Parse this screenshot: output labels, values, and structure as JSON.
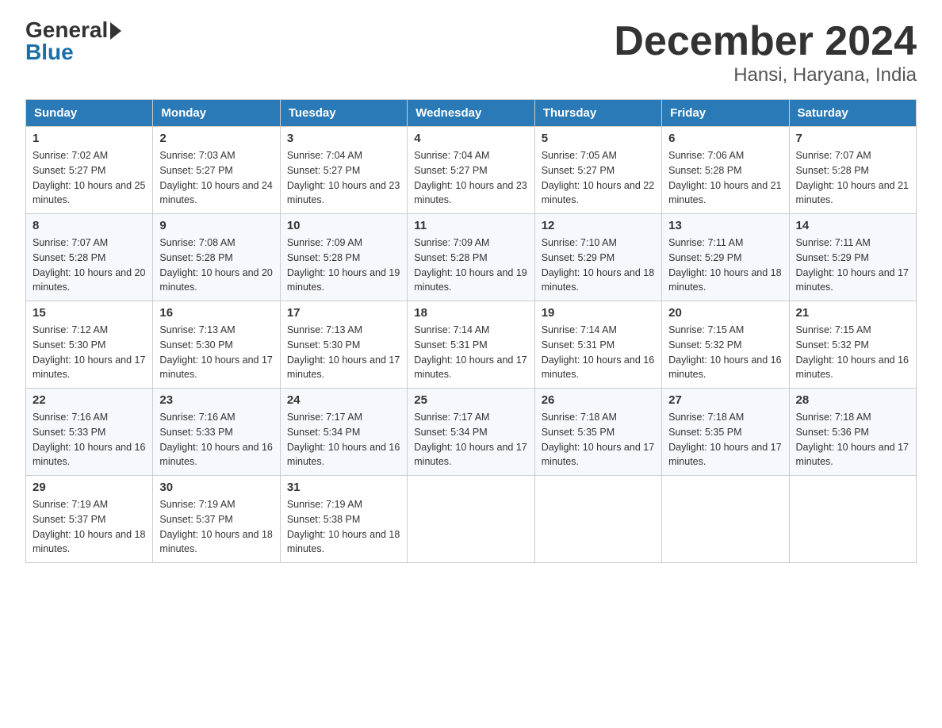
{
  "header": {
    "logo_general": "General",
    "logo_blue": "Blue",
    "month_title": "December 2024",
    "location": "Hansi, Haryana, India"
  },
  "weekdays": [
    "Sunday",
    "Monday",
    "Tuesday",
    "Wednesday",
    "Thursday",
    "Friday",
    "Saturday"
  ],
  "weeks": [
    [
      {
        "day": "1",
        "sunrise": "7:02 AM",
        "sunset": "5:27 PM",
        "daylight": "10 hours and 25 minutes."
      },
      {
        "day": "2",
        "sunrise": "7:03 AM",
        "sunset": "5:27 PM",
        "daylight": "10 hours and 24 minutes."
      },
      {
        "day": "3",
        "sunrise": "7:04 AM",
        "sunset": "5:27 PM",
        "daylight": "10 hours and 23 minutes."
      },
      {
        "day": "4",
        "sunrise": "7:04 AM",
        "sunset": "5:27 PM",
        "daylight": "10 hours and 23 minutes."
      },
      {
        "day": "5",
        "sunrise": "7:05 AM",
        "sunset": "5:27 PM",
        "daylight": "10 hours and 22 minutes."
      },
      {
        "day": "6",
        "sunrise": "7:06 AM",
        "sunset": "5:28 PM",
        "daylight": "10 hours and 21 minutes."
      },
      {
        "day": "7",
        "sunrise": "7:07 AM",
        "sunset": "5:28 PM",
        "daylight": "10 hours and 21 minutes."
      }
    ],
    [
      {
        "day": "8",
        "sunrise": "7:07 AM",
        "sunset": "5:28 PM",
        "daylight": "10 hours and 20 minutes."
      },
      {
        "day": "9",
        "sunrise": "7:08 AM",
        "sunset": "5:28 PM",
        "daylight": "10 hours and 20 minutes."
      },
      {
        "day": "10",
        "sunrise": "7:09 AM",
        "sunset": "5:28 PM",
        "daylight": "10 hours and 19 minutes."
      },
      {
        "day": "11",
        "sunrise": "7:09 AM",
        "sunset": "5:28 PM",
        "daylight": "10 hours and 19 minutes."
      },
      {
        "day": "12",
        "sunrise": "7:10 AM",
        "sunset": "5:29 PM",
        "daylight": "10 hours and 18 minutes."
      },
      {
        "day": "13",
        "sunrise": "7:11 AM",
        "sunset": "5:29 PM",
        "daylight": "10 hours and 18 minutes."
      },
      {
        "day": "14",
        "sunrise": "7:11 AM",
        "sunset": "5:29 PM",
        "daylight": "10 hours and 17 minutes."
      }
    ],
    [
      {
        "day": "15",
        "sunrise": "7:12 AM",
        "sunset": "5:30 PM",
        "daylight": "10 hours and 17 minutes."
      },
      {
        "day": "16",
        "sunrise": "7:13 AM",
        "sunset": "5:30 PM",
        "daylight": "10 hours and 17 minutes."
      },
      {
        "day": "17",
        "sunrise": "7:13 AM",
        "sunset": "5:30 PM",
        "daylight": "10 hours and 17 minutes."
      },
      {
        "day": "18",
        "sunrise": "7:14 AM",
        "sunset": "5:31 PM",
        "daylight": "10 hours and 17 minutes."
      },
      {
        "day": "19",
        "sunrise": "7:14 AM",
        "sunset": "5:31 PM",
        "daylight": "10 hours and 16 minutes."
      },
      {
        "day": "20",
        "sunrise": "7:15 AM",
        "sunset": "5:32 PM",
        "daylight": "10 hours and 16 minutes."
      },
      {
        "day": "21",
        "sunrise": "7:15 AM",
        "sunset": "5:32 PM",
        "daylight": "10 hours and 16 minutes."
      }
    ],
    [
      {
        "day": "22",
        "sunrise": "7:16 AM",
        "sunset": "5:33 PM",
        "daylight": "10 hours and 16 minutes."
      },
      {
        "day": "23",
        "sunrise": "7:16 AM",
        "sunset": "5:33 PM",
        "daylight": "10 hours and 16 minutes."
      },
      {
        "day": "24",
        "sunrise": "7:17 AM",
        "sunset": "5:34 PM",
        "daylight": "10 hours and 16 minutes."
      },
      {
        "day": "25",
        "sunrise": "7:17 AM",
        "sunset": "5:34 PM",
        "daylight": "10 hours and 17 minutes."
      },
      {
        "day": "26",
        "sunrise": "7:18 AM",
        "sunset": "5:35 PM",
        "daylight": "10 hours and 17 minutes."
      },
      {
        "day": "27",
        "sunrise": "7:18 AM",
        "sunset": "5:35 PM",
        "daylight": "10 hours and 17 minutes."
      },
      {
        "day": "28",
        "sunrise": "7:18 AM",
        "sunset": "5:36 PM",
        "daylight": "10 hours and 17 minutes."
      }
    ],
    [
      {
        "day": "29",
        "sunrise": "7:19 AM",
        "sunset": "5:37 PM",
        "daylight": "10 hours and 18 minutes."
      },
      {
        "day": "30",
        "sunrise": "7:19 AM",
        "sunset": "5:37 PM",
        "daylight": "10 hours and 18 minutes."
      },
      {
        "day": "31",
        "sunrise": "7:19 AM",
        "sunset": "5:38 PM",
        "daylight": "10 hours and 18 minutes."
      },
      null,
      null,
      null,
      null
    ]
  ]
}
